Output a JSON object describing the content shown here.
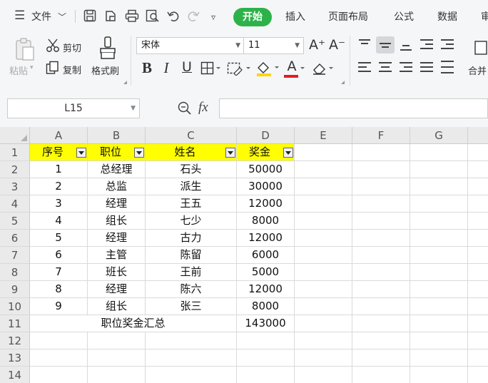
{
  "menu": {
    "file_label": "文件",
    "tabs": [
      {
        "label": "开始",
        "active": true
      },
      {
        "label": "插入"
      },
      {
        "label": "页面布局"
      },
      {
        "label": "公式"
      },
      {
        "label": "数据"
      },
      {
        "label": "审"
      }
    ]
  },
  "ribbon": {
    "paste_label": "粘贴",
    "cut_label": "剪切",
    "copy_label": "复制",
    "format_painter_label": "格式刷",
    "font_name": "宋体",
    "font_size": "11",
    "merge_label": "合并",
    "bold": "B",
    "italic": "I",
    "underline": "U",
    "increase_font": "A⁺",
    "decrease_font": "A⁻",
    "font_color_letter": "A",
    "accent_font_color": "#e02020",
    "accent_fill_color": "#ffd400"
  },
  "formula_bar": {
    "name_box": "L15",
    "fx_label": "fx",
    "content": ""
  },
  "sheet": {
    "columns": [
      "A",
      "B",
      "C",
      "D",
      "E",
      "F",
      "G"
    ],
    "rows": [
      "1",
      "2",
      "3",
      "4",
      "5",
      "6",
      "7",
      "8",
      "9",
      "10",
      "11",
      "12",
      "13",
      "14"
    ],
    "header": [
      "序号",
      "职位",
      "姓名",
      "奖金"
    ],
    "data": [
      [
        "1",
        "总经理",
        "石头",
        "50000"
      ],
      [
        "2",
        "总监",
        "派生",
        "30000"
      ],
      [
        "3",
        "经理",
        "王五",
        "12000"
      ],
      [
        "4",
        "组长",
        "七少",
        "8000"
      ],
      [
        "5",
        "经理",
        "古力",
        "12000"
      ],
      [
        "6",
        "主管",
        "陈留",
        "6000"
      ],
      [
        "7",
        "班长",
        "王前",
        "5000"
      ],
      [
        "8",
        "经理",
        "陈六",
        "12000"
      ],
      [
        "9",
        "组长",
        "张三",
        "8000"
      ]
    ],
    "summary_label": "职位奖金汇总",
    "summary_value": "143000",
    "header_fill": "#ffff00"
  }
}
